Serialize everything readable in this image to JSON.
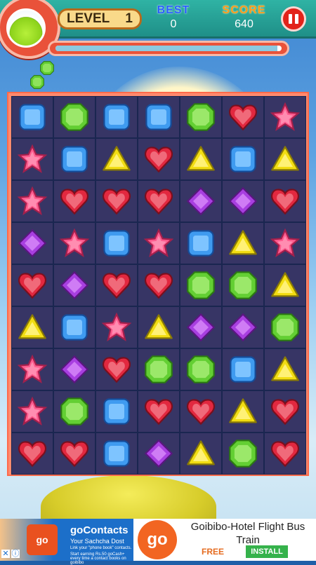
{
  "hud": {
    "level_label": "LEVEL",
    "level_value": "1",
    "best_label": "BEST",
    "best_value": "0",
    "score_label": "SCORE",
    "score_value": "640",
    "progress": 0.98
  },
  "icons": {
    "potion": "potion-icon",
    "pause": "pause-icon",
    "bonus": "green-gem-icon"
  },
  "colors": {
    "blue": "#3f9bf0",
    "green": "#63cf33",
    "red": "#e2283f",
    "pink": "#ff5b8e",
    "yellow": "#f2dd12",
    "purple": "#a83fe0"
  },
  "board": {
    "rows": [
      [
        "blue",
        "green",
        "blue",
        "blue",
        "green",
        "red",
        "pink"
      ],
      [
        "pink",
        "blue",
        "yellow",
        "red",
        "yellow",
        "blue",
        "yellow"
      ],
      [
        "pink",
        "red",
        "red",
        "red",
        "purple",
        "purple",
        "red"
      ],
      [
        "purple",
        "pink",
        "blue",
        "pink",
        "blue",
        "yellow",
        "pink"
      ],
      [
        "red",
        "purple",
        "red",
        "red",
        "green",
        "green",
        "yellow"
      ],
      [
        "yellow",
        "blue",
        "pink",
        "yellow",
        "purple",
        "purple",
        "green"
      ],
      [
        "pink",
        "purple",
        "red",
        "green",
        "green",
        "blue",
        "yellow"
      ],
      [
        "pink",
        "green",
        "blue",
        "red",
        "red",
        "yellow",
        "red"
      ],
      [
        "red",
        "red",
        "blue",
        "purple",
        "yellow",
        "green",
        "red"
      ]
    ]
  },
  "ad": {
    "left_title": "goContacts",
    "left_subtitle": "Your Sachcha Dost",
    "left_line1": "Link your \"phone book\" contacts.",
    "left_line2": "Start earning Rs.50 goCash+ every time a contact books on goibibo",
    "app_icon_text": "go",
    "right_logo_text": "go",
    "right_title": "Goibibo-Hotel Flight Bus Train",
    "free_label": "FREE",
    "install_label": "INSTALL",
    "close_icon": "close-icon",
    "info_icon": "info-icon"
  }
}
